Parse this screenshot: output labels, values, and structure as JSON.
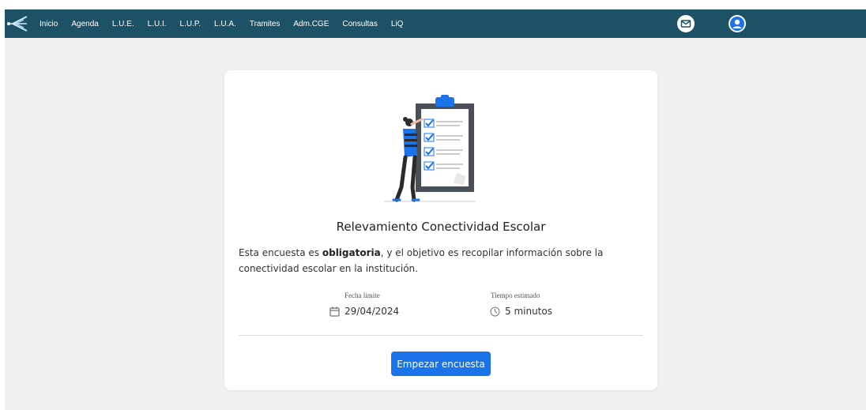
{
  "nav": {
    "items": [
      "Inicio",
      "Agenda",
      "L.U.E.",
      "L.U.I.",
      "L.U.P.",
      "L.U.A.",
      "Tramites",
      "Adm.CGE",
      "Consultas",
      "LiQ"
    ]
  },
  "icons": {
    "logo": "logo-icon",
    "mail": "mail-icon",
    "user": "user-avatar-icon",
    "calendar": "calendar-icon",
    "clock": "clock-icon"
  },
  "colors": {
    "topbar": "#1d5166",
    "background": "#f0f0f0",
    "primary_button": "#1a73e8",
    "illustration_accent": "#1a73e8"
  },
  "survey": {
    "title": "Relevamiento Conectividad Escolar",
    "description_prefix": "Esta encuesta es ",
    "description_bold": "obligatoria",
    "description_suffix": ", y el objetivo es recopilar información sobre la conectividad escolar en la institución.",
    "deadline_label": "Fecha límite",
    "deadline_value": "29/04/2024",
    "time_label": "Tiempo estimado",
    "time_value": "5 minutos",
    "start_button": "Empezar encuesta"
  }
}
